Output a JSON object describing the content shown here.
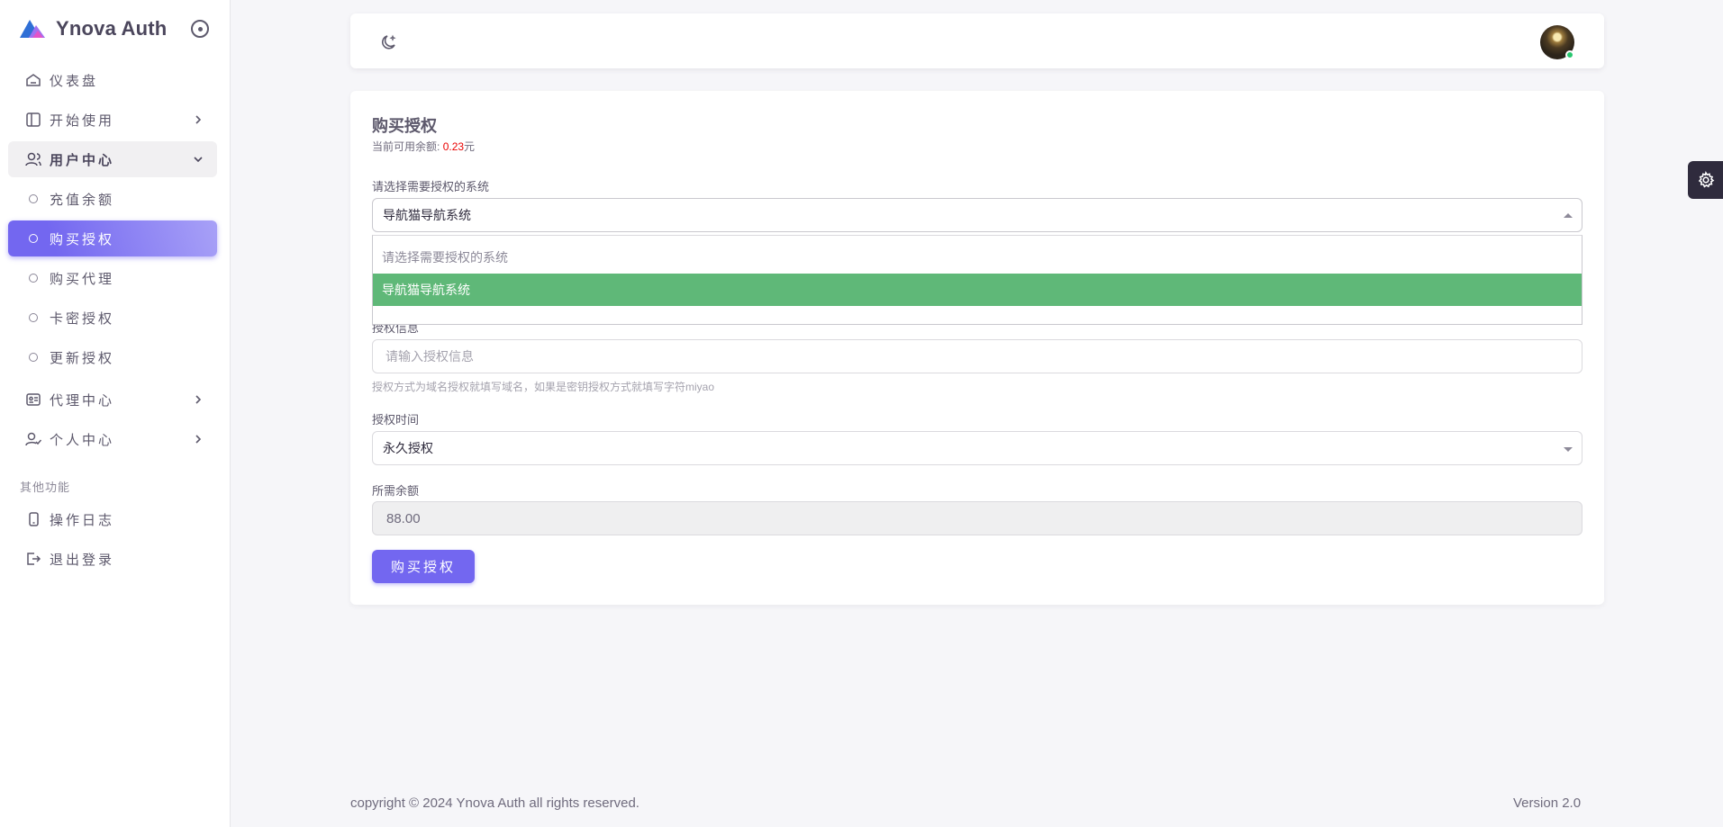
{
  "brand": {
    "name": "Ynova Auth"
  },
  "sidebar": {
    "items": [
      {
        "label": "仪表盘"
      },
      {
        "label": "开始使用"
      },
      {
        "label": "用户中心"
      },
      {
        "label": "充值余额"
      },
      {
        "label": "购买授权"
      },
      {
        "label": "购买代理"
      },
      {
        "label": "卡密授权"
      },
      {
        "label": "更新授权"
      },
      {
        "label": "代理中心"
      },
      {
        "label": "个人中心"
      },
      {
        "label": "操作日志"
      },
      {
        "label": "退出登录"
      }
    ],
    "section_other": "其他功能"
  },
  "card": {
    "title": "购买授权",
    "balance_prefix": "当前可用余额:",
    "balance_value": "0.23",
    "balance_unit": "元",
    "system_label": "请选择需要授权的系统",
    "system_selected": "导航猫导航系统",
    "system_options": [
      "请选择需要授权的系统",
      "导航猫导航系统"
    ],
    "auth_info_label": "授权信息",
    "auth_info_placeholder": "请输入授权信息",
    "auth_info_help": "授权方式为域名授权就填写域名，如果是密钥授权方式就填写字符miyao",
    "time_label": "授权时间",
    "time_selected": "永久授权",
    "cost_label": "所需余额",
    "cost_value": "88.00",
    "buy_button": "购买授权"
  },
  "footer": {
    "copyright": "copyright © 2024 Ynova Auth all rights reserved.",
    "version": "Version 2.0"
  },
  "colors": {
    "primary": "#7367f0",
    "selected_option": "#5fb878",
    "balance": "#ea0000",
    "status_online": "#28c76f"
  }
}
